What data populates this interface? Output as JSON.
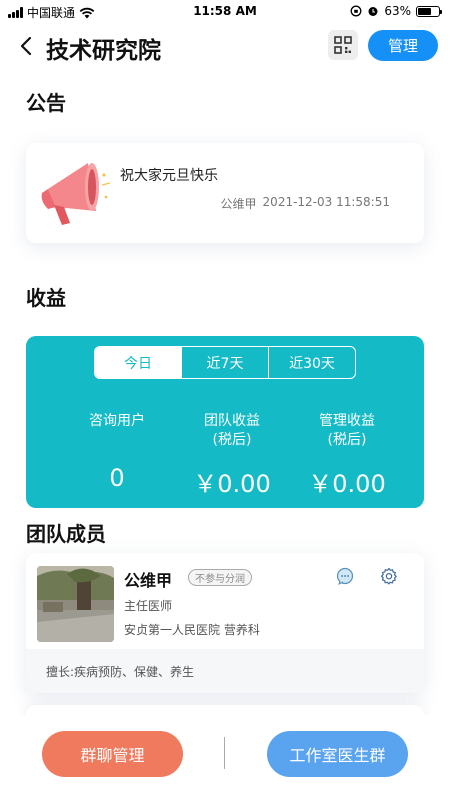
{
  "status_bar": {
    "carrier": "中国联通",
    "time": "11:58 AM",
    "battery": "63%",
    "battery_level": 0.63
  },
  "nav": {
    "title": "技术研究院",
    "manage_label": "管理",
    "icons": [
      "back-arrow-icon",
      "qr-code-icon"
    ]
  },
  "notice_section": {
    "title": "公告",
    "text": "祝大家元旦快乐",
    "author": "公维甲",
    "datetime": "2021-12-03 11:58:51",
    "icon": "megaphone-icon"
  },
  "revenue_section": {
    "title": "收益",
    "tabs": [
      {
        "label": "今日",
        "active": true
      },
      {
        "label": "近7天",
        "active": false
      },
      {
        "label": "近30天",
        "active": false
      }
    ],
    "metrics": [
      {
        "label_line1": "咨询用户",
        "label_line2": "",
        "value": "0"
      },
      {
        "label_line1": "团队收益",
        "label_line2": "(税后)",
        "value": "￥0.00"
      },
      {
        "label_line1": "管理收益",
        "label_line2": "(税后)",
        "value": "￥0.00"
      }
    ],
    "color": "#14bac5"
  },
  "team_section": {
    "title": "团队成员",
    "members": [
      {
        "name": "公维甲",
        "tag": "不参与分润",
        "role": "主任医师",
        "hospital": "安贞第一人民医院 营养科",
        "specialty": "擅长:疾病预防、保健、养生"
      }
    ]
  },
  "bottom_bar": {
    "group_chat_label": "群聊管理",
    "studio_group_label": "工作室医生群",
    "group_color": "#ef7a5e",
    "studio_color": "#5aa4ef"
  }
}
